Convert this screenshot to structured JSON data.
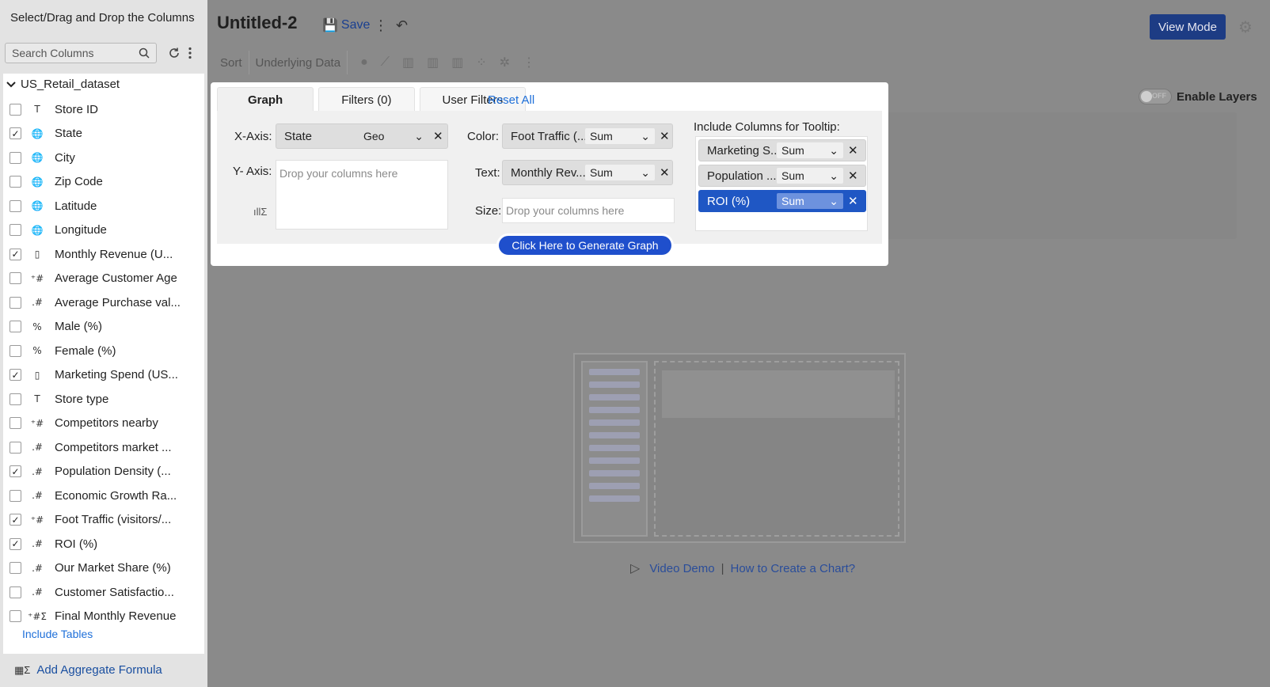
{
  "sidebar": {
    "title": "Select/Drag and Drop the Columns",
    "search_placeholder": "Search Columns",
    "dataset_name": "US_Retail_dataset",
    "columns": [
      {
        "label": "Store ID",
        "icon": "T",
        "checked": false
      },
      {
        "label": "State",
        "icon": "globe",
        "checked": true
      },
      {
        "label": "City",
        "icon": "globe",
        "checked": false
      },
      {
        "label": "Zip Code",
        "icon": "globe",
        "checked": false
      },
      {
        "label": "Latitude",
        "icon": "globe",
        "checked": false
      },
      {
        "label": "Longitude",
        "icon": "globe",
        "checked": false
      },
      {
        "label": "Monthly Revenue (U...",
        "icon": "currency",
        "checked": true
      },
      {
        "label": "Average Customer Age",
        "icon": "integer",
        "checked": false
      },
      {
        "label": "Average Purchase val...",
        "icon": "decimal",
        "checked": false
      },
      {
        "label": "Male (%)",
        "icon": "percent",
        "checked": false
      },
      {
        "label": "Female (%)",
        "icon": "percent",
        "checked": false
      },
      {
        "label": "Marketing Spend (US...",
        "icon": "currency",
        "checked": true
      },
      {
        "label": "Store type",
        "icon": "T",
        "checked": false
      },
      {
        "label": "Competitors nearby",
        "icon": "integer",
        "checked": false
      },
      {
        "label": "Competitors market ...",
        "icon": "decimal",
        "checked": false
      },
      {
        "label": "Population Density (...",
        "icon": "decimal",
        "checked": true
      },
      {
        "label": "Economic Growth Ra...",
        "icon": "decimal",
        "checked": false
      },
      {
        "label": "Foot Traffic (visitors/...",
        "icon": "integer",
        "checked": true
      },
      {
        "label": "ROI (%)",
        "icon": "decimal",
        "checked": true
      },
      {
        "label": "Our Market Share (%)",
        "icon": "decimal",
        "checked": false
      },
      {
        "label": "Customer Satisfactio...",
        "icon": "decimal",
        "checked": false
      },
      {
        "label": "Final Monthly Revenue",
        "icon": "formula",
        "checked": false
      }
    ],
    "include_tables": "Include Tables",
    "add_formula": "Add Aggregate Formula"
  },
  "header": {
    "title": "Untitled-2",
    "save_label": "Save",
    "view_mode_label": "View Mode"
  },
  "toolbar": {
    "sort_label": "Sort",
    "underlying_data_label": "Underlying Data"
  },
  "enable_layers": {
    "label": "Enable Layers",
    "toggle_text": "OFF"
  },
  "panel": {
    "tabs": {
      "graph": "Graph",
      "filters": "Filters  (0)",
      "user_filters": "User Filters"
    },
    "reset_all": "Reset All",
    "x_axis": {
      "label": "X-Axis:",
      "column": "State",
      "agg": "Geo"
    },
    "y_axis": {
      "label": "Y- Axis:",
      "placeholder": "Drop your columns here"
    },
    "color": {
      "label": "Color:",
      "column": "Foot Traffic (...",
      "agg": "Sum"
    },
    "text": {
      "label": "Text:",
      "column": "Monthly Rev...",
      "agg": "Sum"
    },
    "size": {
      "label": "Size:",
      "placeholder": "Drop your columns here"
    },
    "tooltip": {
      "label": "Include Columns for Tooltip:",
      "items": [
        {
          "column": "Marketing S...",
          "agg": "Sum"
        },
        {
          "column": "Population ...",
          "agg": "Sum"
        },
        {
          "column": "ROI (%)",
          "agg": "Sum"
        }
      ]
    },
    "generate_label": "Click Here to Generate Graph"
  },
  "help": {
    "video_demo": "Video Demo",
    "separator": "|",
    "how_to": "How to Create a Chart?"
  }
}
